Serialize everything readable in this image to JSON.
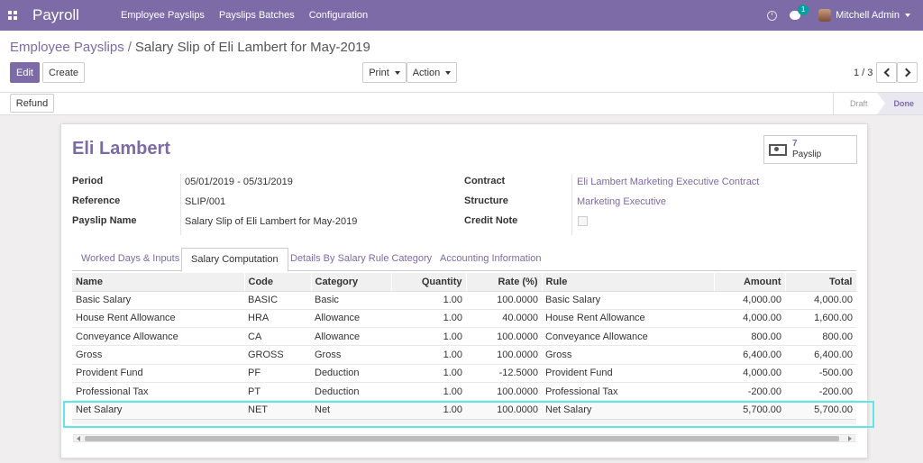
{
  "navbar": {
    "brand": "Payroll",
    "menu": [
      "Employee Payslips",
      "Payslips Batches",
      "Configuration"
    ],
    "chat_count": "1",
    "user_name": "Mitchell Admin",
    "accent_color": "#7c6ba6"
  },
  "breadcrumb": {
    "parent": "Employee Payslips",
    "separator": "/",
    "current": "Salary Slip of Eli Lambert for May-2019"
  },
  "toolbar": {
    "edit_label": "Edit",
    "create_label": "Create",
    "print_label": "Print",
    "action_label": "Action",
    "pager": "1 / 3",
    "refund_label": "Refund"
  },
  "status": {
    "steps": [
      "Draft",
      "Done"
    ],
    "active": "Done"
  },
  "form": {
    "employee_name": "Eli Lambert",
    "smart_button": {
      "count": "7",
      "label": "Payslip"
    },
    "left_fields": [
      {
        "label": "Period",
        "value": "05/01/2019 - 05/31/2019"
      },
      {
        "label": "Reference",
        "value": "SLIP/001"
      },
      {
        "label": "Payslip Name",
        "value": "Salary Slip of Eli Lambert for May-2019"
      }
    ],
    "right_fields": [
      {
        "label": "Contract",
        "value": "Eli Lambert Marketing Executive Contract"
      },
      {
        "label": "Structure",
        "value": "Marketing Executive"
      },
      {
        "label": "Credit Note",
        "value": ""
      }
    ]
  },
  "tabs": [
    {
      "label": "Worked Days & Inputs"
    },
    {
      "label": "Salary Computation"
    },
    {
      "label": "Details By Salary Rule Category"
    },
    {
      "label": "Accounting Information"
    }
  ],
  "table": {
    "headers": [
      "Name",
      "Code",
      "Category",
      "Quantity",
      "Rate (%)",
      "Rule",
      "Amount",
      "Total"
    ],
    "rows": [
      [
        "Basic Salary",
        "BASIC",
        "Basic",
        "1.00",
        "100.0000",
        "Basic Salary",
        "4,000.00",
        "4,000.00"
      ],
      [
        "House Rent Allowance",
        "HRA",
        "Allowance",
        "1.00",
        "40.0000",
        "House Rent Allowance",
        "4,000.00",
        "1,600.00"
      ],
      [
        "Conveyance Allowance",
        "CA",
        "Allowance",
        "1.00",
        "100.0000",
        "Conveyance Allowance",
        "800.00",
        "800.00"
      ],
      [
        "Gross",
        "GROSS",
        "Gross",
        "1.00",
        "100.0000",
        "Gross",
        "6,400.00",
        "6,400.00"
      ],
      [
        "Provident Fund",
        "PF",
        "Deduction",
        "1.00",
        "-12.5000",
        "Provident Fund",
        "4,000.00",
        "-500.00"
      ],
      [
        "Professional Tax",
        "PT",
        "Deduction",
        "1.00",
        "100.0000",
        "Professional Tax",
        "-200.00",
        "-200.00"
      ],
      [
        "Net Salary",
        "NET",
        "Net",
        "1.00",
        "100.0000",
        "Net Salary",
        "5,700.00",
        "5,700.00"
      ]
    ]
  }
}
